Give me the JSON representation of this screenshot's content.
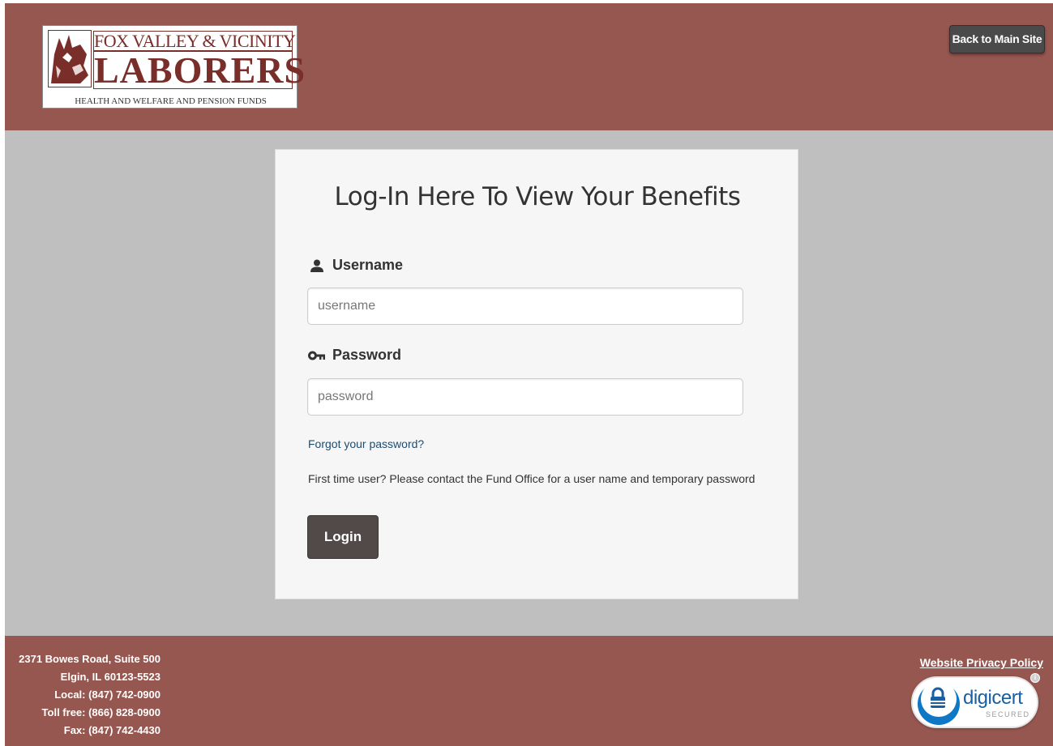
{
  "header": {
    "logo": {
      "line1": "FOX VALLEY & VICINITY",
      "line2": "LABORERS",
      "line3": "HEALTH AND WELFARE AND PENSION FUNDS"
    },
    "back_button_label": "Back to Main Site"
  },
  "login": {
    "title": "Log-In Here To View Your Benefits",
    "username_label": "Username",
    "username_placeholder": "username",
    "username_value": "",
    "password_label": "Password",
    "password_placeholder": "password",
    "password_value": "",
    "forgot_link": "Forgot your password?",
    "first_time_text": "First time user? Please contact the Fund Office for a user name and temporary password",
    "login_button_label": "Login"
  },
  "footer": {
    "address_lines": [
      "2371 Bowes Road, Suite 500",
      "Elgin, IL 60123-5523",
      "Local: (847) 742-0900",
      "Toll free: (866) 828-0900",
      "Fax: (847) 742-4430"
    ],
    "privacy_link": "Website Privacy Policy",
    "seal": {
      "brand": "digicert",
      "subtext": "SECURED",
      "info_glyph": "i"
    }
  },
  "colors": {
    "brand_maroon": "#965750",
    "page_gray": "#bfbfbf",
    "card_bg": "#f6f6f6",
    "button_dark": "#514a48",
    "link_blue": "#1e4c6e",
    "digicert_blue": "#0e78c6"
  },
  "icons": {
    "username": "user-icon",
    "password": "key-icon",
    "seal_lock": "lock-icon",
    "logo_mark": "fox-logo-icon"
  }
}
